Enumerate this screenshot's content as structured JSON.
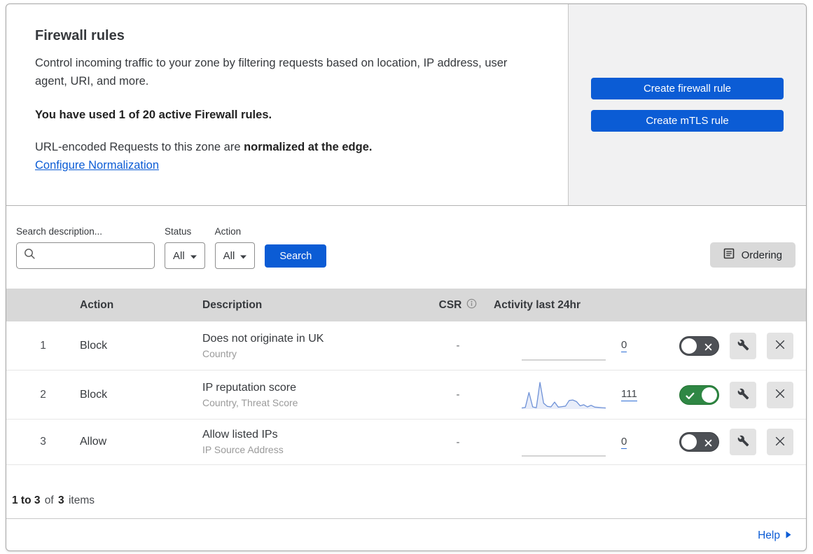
{
  "colors": {
    "accent_blue": "#0b5cd5",
    "toggle_on_green": "#2f8744",
    "toggle_off_gray": "#4d5055",
    "sparkline_blue": "#6e91d7",
    "panel_gray": "#f1f1f2",
    "table_header_gray": "#d8d8d8"
  },
  "header": {
    "title": "Firewall rules",
    "description": "Control incoming traffic to your zone by filtering requests based on location, IP address, user agent, URI, and more.",
    "usage_notice": "You have used 1 of 20 active Firewall rules.",
    "normalization_prefix": "URL-encoded Requests to this zone are ",
    "normalization_bold": "normalized at the edge.",
    "configure_link": "Configure Normalization",
    "create_firewall_button": "Create firewall rule",
    "create_mtls_button": "Create mTLS rule"
  },
  "toolbar": {
    "search_label": "Search description...",
    "status_label": "Status",
    "status_value": "All",
    "action_label": "Action",
    "action_value": "All",
    "search_button": "Search",
    "ordering_button": "Ordering"
  },
  "table": {
    "headers": {
      "action": "Action",
      "description": "Description",
      "csr": "CSR",
      "activity": "Activity last 24hr"
    },
    "rows": [
      {
        "priority": "1",
        "action": "Block",
        "description": "Does not originate in UK",
        "match_fields": "Country",
        "csr": "-",
        "activity_count": "0",
        "enabled": false,
        "sparkline": []
      },
      {
        "priority": "2",
        "action": "Block",
        "description": "IP reputation score",
        "match_fields": "Country, Threat Score",
        "csr": "-",
        "activity_count": "111",
        "enabled": true,
        "sparkline": [
          4,
          6,
          62,
          8,
          5,
          100,
          22,
          10,
          8,
          26,
          7,
          9,
          11,
          32,
          34,
          28,
          12,
          16,
          8,
          14,
          7,
          6,
          5,
          4
        ]
      },
      {
        "priority": "3",
        "action": "Allow",
        "description": "Allow listed IPs",
        "match_fields": "IP Source Address",
        "csr": "-",
        "activity_count": "0",
        "enabled": false,
        "sparkline": []
      }
    ]
  },
  "pagination": {
    "range": "1 to 3",
    "of_word": "of",
    "total": "3",
    "items_word": "items"
  },
  "footer": {
    "help": "Help"
  }
}
